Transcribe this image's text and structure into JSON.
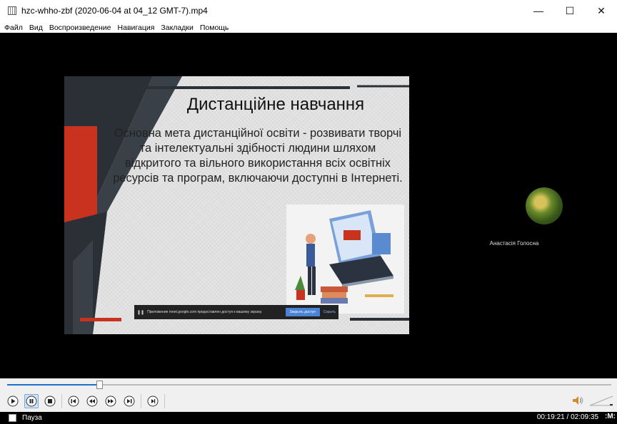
{
  "window": {
    "title": "hzc-whho-zbf (2020-06-04 at 04_12 GMT-7).mp4",
    "app_icon": "vlc-cone-icon",
    "minimize_glyph": "—",
    "maximize_glyph": "☐",
    "close_glyph": "✕"
  },
  "menu": {
    "items": [
      "Файл",
      "Вид",
      "Воспроизведение",
      "Навигация",
      "Закладки",
      "Помощь"
    ]
  },
  "slide": {
    "title": "Дистанційне навчання",
    "body": "Основна мета дистанційної освіти - розвивати творчі та інтелектуальні здібності людини шляхом відкритого та вільного використання всіх освітніх ресурсів та програм, включаючи доступні в Інтернеті.",
    "colors": {
      "accent_red": "#c8321e",
      "dark": "#2b3036",
      "bg": "#e4e4e4"
    }
  },
  "screen_share_notice": {
    "text": "Приложение meet.google.com предоставлен доступ к вашему экрану.",
    "stop_button": "Закрыть доступ",
    "hide_link": "Скрыть"
  },
  "participant": {
    "name": "Анастасія Голосна"
  },
  "playback": {
    "state": "paused",
    "progress": 0.152,
    "status_text": "Пауза",
    "time": "00:19:21 / 02:09:35",
    "extra": ":M:",
    "controls": [
      "play-icon",
      "pause-icon",
      "stop-icon",
      "previous-icon",
      "rewind-icon",
      "forward-icon",
      "next-icon",
      "frame-step-icon"
    ]
  },
  "volume": {
    "icon": "speaker-icon"
  }
}
